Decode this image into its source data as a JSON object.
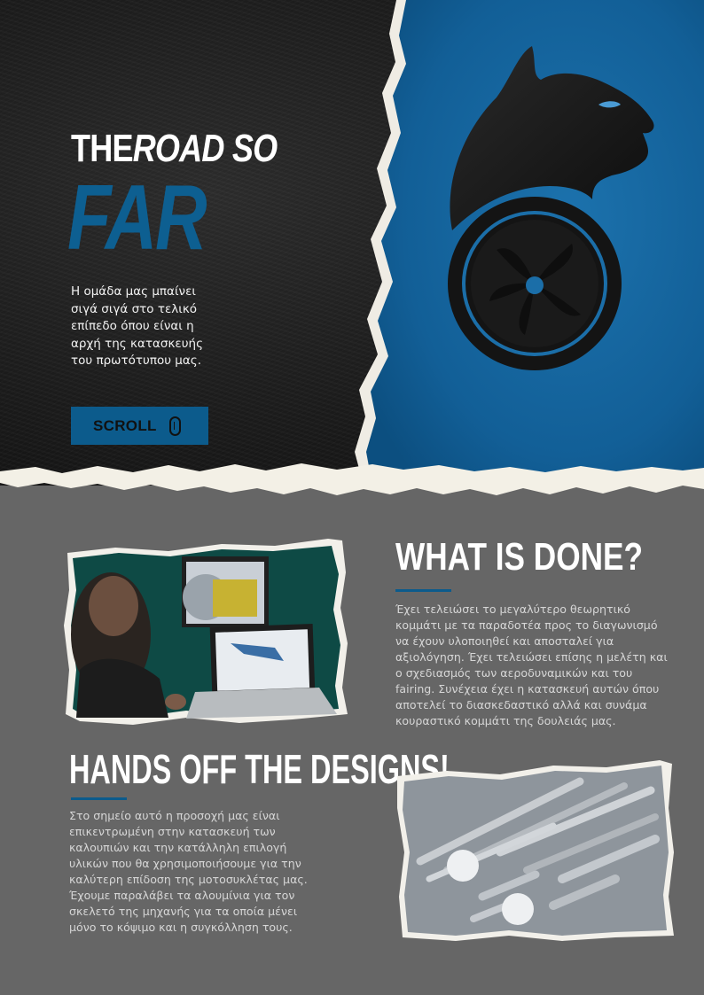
{
  "hero": {
    "tagline_plain": "THE",
    "tagline_italic": "ROAD SO",
    "title": "FAR",
    "intro": " Η ομάδα μας μπαίνει σιγά σιγά στο τελικό επίπεδο όπου είναι η αρχή της κατασκευής του πρωτότυπου μας.",
    "scroll_label": "SCROLL",
    "scroll_icon": "mouse-scroll-icon"
  },
  "section_done": {
    "heading": "WHAT IS DONE?",
    "body": "Έχει τελειώσει το μεγαλύτερο θεωρητικό κομμάτι με τα παραδοτέα προς το διαγωνισμό να έχουν υλοποιηθεί και αποσταλεί για αξιολόγηση. Έχει τελειώσει επίσης η μελέτη και ο σχεδιασμός των αεροδυναμικών και του fairing. Συνέχεια έχει η κατασκευή αυτών όπου αποτελεί το διασκεδαστικό αλλά και συνάμα κουραστικό κομμάτι της δουλειάς μας."
  },
  "section_hands": {
    "heading": "HANDS OFF THE DESIGNS!",
    "body": " Στο σημείο αυτό η προσοχή μας είναι επικεντρωμένη στην κατασκευή των καλουπιών και την κατάλληλη επιλογή υλικών που θα χρησιμοποιήσουμε για την καλύτερη επίδοση της μοτοσυκλέτας μας. Έχουμε παραλάβει τα αλουμίνια για τον σκελετό της μηχανής για τα οποία μένει μόνο το κόψιμο και η συγκόλληση τους."
  },
  "colors": {
    "accent_blue": "#0c5b8c",
    "hero_blue": "#1565a0",
    "dark_bg": "#161616",
    "gray_bg": "#666666",
    "paper": "#f3f0e6"
  }
}
